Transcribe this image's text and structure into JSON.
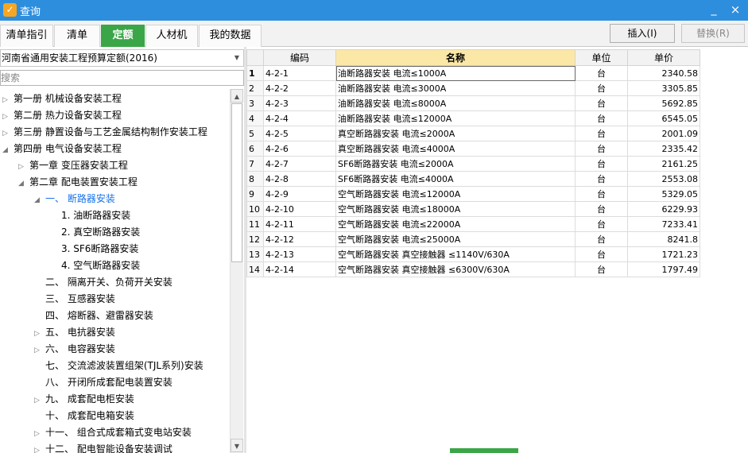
{
  "window": {
    "title": "查询",
    "icon": "app-icon",
    "minimize": "_",
    "close": "×"
  },
  "tabs": [
    "清单指引",
    "清单",
    "定额",
    "人材机",
    "我的数据"
  ],
  "actions": {
    "insert": "插入(I)",
    "replace": "替换(R)"
  },
  "library": {
    "selected": "河南省通用安装工程预算定额(2016)"
  },
  "search": {
    "placeholder": "搜索"
  },
  "tree": [
    {
      "label": "第一册 机械设备安装工程"
    },
    {
      "label": "第二册 热力设备安装工程"
    },
    {
      "label": "第三册 静置设备与工艺金属结构制作安装工程"
    },
    {
      "label": "第四册 电气设备安装工程"
    },
    {
      "label": "第一章 变压器安装工程"
    },
    {
      "label": "第二章 配电装置安装工程"
    },
    {
      "label": "一、 断路器安装"
    },
    {
      "label": "1. 油断路器安装"
    },
    {
      "label": "2. 真空断路器安装"
    },
    {
      "label": "3. SF6断路器安装"
    },
    {
      "label": "4. 空气断路器安装"
    },
    {
      "label": "二、 隔离开关、负荷开关安装"
    },
    {
      "label": "三、 互感器安装"
    },
    {
      "label": "四、 熔断器、避雷器安装"
    },
    {
      "label": "五、 电抗器安装"
    },
    {
      "label": "六、 电容器安装"
    },
    {
      "label": "七、 交流滤波装置组架(TJL系列)安装"
    },
    {
      "label": "八、 开闭所成套配电装置安装"
    },
    {
      "label": "九、 成套配电柜安装"
    },
    {
      "label": "十、 成套配电箱安装"
    },
    {
      "label": "十一、 组合式成套箱式变电站安装"
    },
    {
      "label": "十二、 配电智能设备安装调试"
    }
  ],
  "grid": {
    "headers": {
      "code": "编码",
      "name": "名称",
      "unit": "单位",
      "price": "单价"
    },
    "rows": [
      {
        "no": "1",
        "code": "4-2-1",
        "name": "油断路器安装 电流≤1000A",
        "unit": "台",
        "price": "2340.58"
      },
      {
        "no": "2",
        "code": "4-2-2",
        "name": "油断路器安装 电流≤3000A",
        "unit": "台",
        "price": "3305.85"
      },
      {
        "no": "3",
        "code": "4-2-3",
        "name": "油断路器安装 电流≤8000A",
        "unit": "台",
        "price": "5692.85"
      },
      {
        "no": "4",
        "code": "4-2-4",
        "name": "油断路器安装 电流≤12000A",
        "unit": "台",
        "price": "6545.05"
      },
      {
        "no": "5",
        "code": "4-2-5",
        "name": "真空断路器安装 电流≤2000A",
        "unit": "台",
        "price": "2001.09"
      },
      {
        "no": "6",
        "code": "4-2-6",
        "name": "真空断路器安装 电流≤4000A",
        "unit": "台",
        "price": "2335.42"
      },
      {
        "no": "7",
        "code": "4-2-7",
        "name": "SF6断路器安装 电流≤2000A",
        "unit": "台",
        "price": "2161.25"
      },
      {
        "no": "8",
        "code": "4-2-8",
        "name": "SF6断路器安装 电流≤4000A",
        "unit": "台",
        "price": "2553.08"
      },
      {
        "no": "9",
        "code": "4-2-9",
        "name": "空气断路器安装 电流≤12000A",
        "unit": "台",
        "price": "5329.05"
      },
      {
        "no": "10",
        "code": "4-2-10",
        "name": "空气断路器安装 电流≤18000A",
        "unit": "台",
        "price": "6229.93"
      },
      {
        "no": "11",
        "code": "4-2-11",
        "name": "空气断路器安装 电流≤22000A",
        "unit": "台",
        "price": "7233.41"
      },
      {
        "no": "12",
        "code": "4-2-12",
        "name": "空气断路器安装 电流≤25000A",
        "unit": "台",
        "price": "8241.8"
      },
      {
        "no": "13",
        "code": "4-2-13",
        "name": "空气断路器安装 真空接触器 ≤1140V/630A",
        "unit": "台",
        "price": "1721.23"
      },
      {
        "no": "14",
        "code": "4-2-14",
        "name": "空气断路器安装 真空接触器 ≤6300V/630A",
        "unit": "台",
        "price": "1797.49"
      }
    ]
  }
}
